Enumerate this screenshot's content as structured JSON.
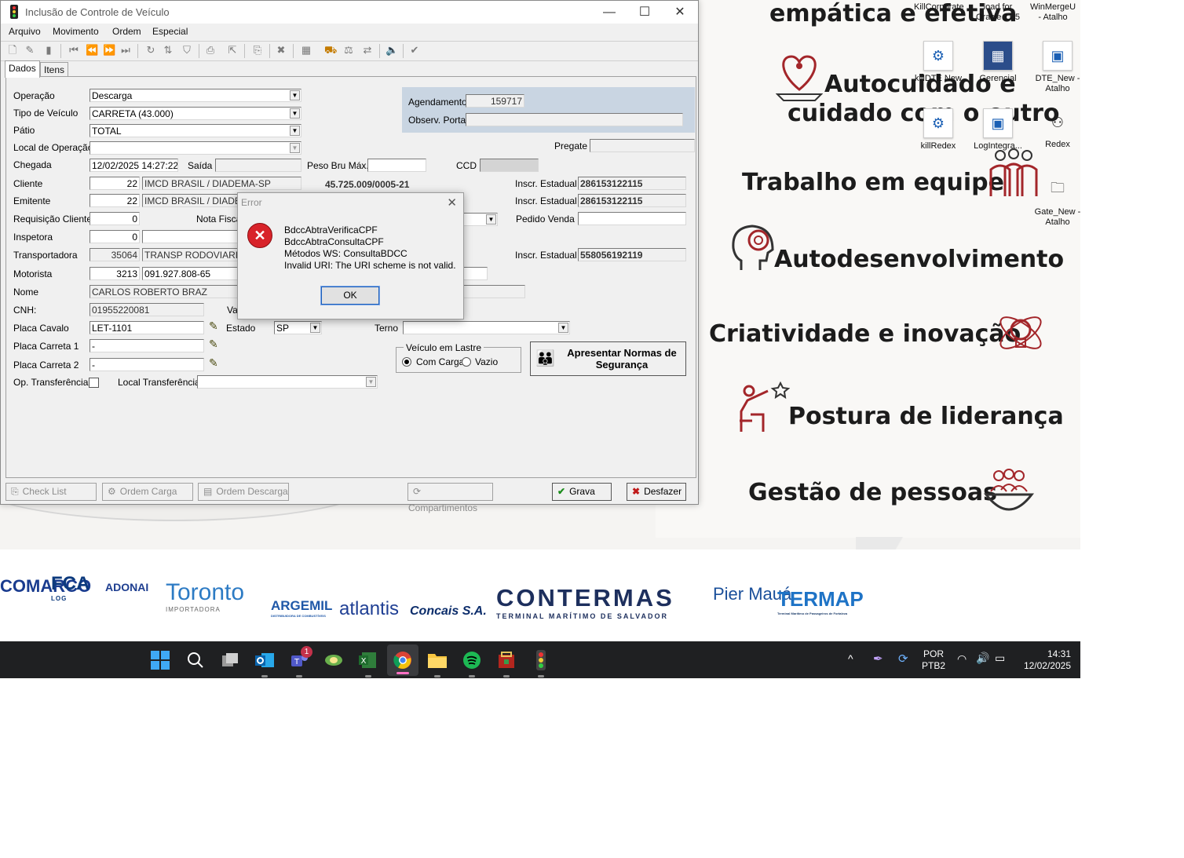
{
  "desktop": {
    "values": [
      {
        "text": "empática e efetiva"
      },
      {
        "text": "Autocuidado e"
      },
      {
        "text": "cuidado com o outro"
      },
      {
        "text": "Trabalho em equipe"
      },
      {
        "text": "Autodesenvolvimento"
      },
      {
        "text": "Criatividade e inovação"
      },
      {
        "text": "Postura de liderança"
      },
      {
        "text": "Gestão de pessoas"
      }
    ],
    "icons": [
      {
        "label": "KillCorporate",
        "icon": "gear-icon"
      },
      {
        "label": "load for Oracle 11.5",
        "icon": "app-icon"
      },
      {
        "label": "WinMergeU - Atalho",
        "icon": "shortcut-icon"
      },
      {
        "label": "killDTE New",
        "icon": "gear-icon"
      },
      {
        "label": "Gerencial",
        "icon": "app-icon"
      },
      {
        "label": "DTE_New - Atalho",
        "icon": "shortcut-icon"
      },
      {
        "label": "killRedex",
        "icon": "gear-icon"
      },
      {
        "label": "LogIntegra...",
        "icon": "shortcut-icon"
      },
      {
        "label": "Redex",
        "icon": "app-icon"
      },
      {
        "label": "Gate_New - Atalho",
        "icon": "shortcut-icon"
      }
    ],
    "logos": [
      {
        "name": "COMARCO",
        "color": "#1a3c8f"
      },
      {
        "name": "FCA",
        "sub": "LOG",
        "color": "#0c3a7d"
      },
      {
        "name": "ADONAI",
        "color": "#1d3d8f"
      },
      {
        "name": "Toronto",
        "sub": "IMPORTADORA",
        "color": "#2d7bc4"
      },
      {
        "name": "ARGEMIL",
        "sub": "DISTRIBUIDORA DE COMBUSTÍVEIS",
        "color": "#1f58a8"
      },
      {
        "name": "atlantis",
        "color": "#1f3f94"
      },
      {
        "name": "Concais S.A.",
        "color": "#0c2d6b"
      },
      {
        "name": "CONTERMAS",
        "sub": "TERMINAL MARÍTIMO DE SALVADOR",
        "color": "#1d2f5d"
      },
      {
        "name": "Pier Mauá",
        "color": "#1a4f9a"
      },
      {
        "name": "TERMAP",
        "sub": "Terminal Marítimo de Passageiros de Fortaleza",
        "color": "#1e73c6"
      }
    ],
    "accent": "#a3262a"
  },
  "taskbar": {
    "apps": [
      "windows-start-icon",
      "search-icon",
      "task-view-icon",
      "outlook-icon",
      "teams-icon",
      "app-icon",
      "excel-icon",
      "chrome-icon",
      "file-explorer-icon",
      "spotify-icon",
      "toolbox-icon",
      "traffic-light-icon"
    ],
    "teams_badge": "1",
    "lang_top": "POR",
    "lang_bottom": "PTB2",
    "time": "14:31",
    "date": "12/02/2025"
  },
  "window": {
    "title": "Inclusão de Controle de Veículo",
    "menu": [
      "Arquivo",
      "Movimento",
      "Ordem",
      "Especial"
    ],
    "tabs": [
      "Dados",
      "Itens"
    ],
    "form": {
      "operacao_label": "Operação",
      "operacao": "Descarga",
      "tipo_veiculo_label": "Tipo de Veículo",
      "tipo_veiculo": "CARRETA (43.000)",
      "patio_label": "Pátio",
      "patio": "TOTAL",
      "local_operacao_label": "Local de Operação",
      "local_operacao": "",
      "chegada_label": "Chegada",
      "chegada": "12/02/2025 14:27:22",
      "saida_label": "Saída",
      "saida": "",
      "peso_label": "Peso Bru Máx.",
      "peso": "",
      "ccd_label": "CCD",
      "ccd": "",
      "agendamento_label": "Agendamento",
      "agendamento": "159717",
      "observ_label": "Observ. Portal",
      "observ": "",
      "pregate_label": "Pregate",
      "pregate": "",
      "cliente_label": "Cliente",
      "cliente_cod": "22",
      "cliente_nome": "IMCD BRASIL / DIADEMA-SP",
      "cliente_cnpj": "45.725.009/0005-21",
      "ie_label": "Inscr. Estadual",
      "cliente_ie": "286153122115",
      "emitente_label": "Emitente",
      "emitente_cod": "22",
      "emitente_nome": "IMCD BRASIL / DIADEM",
      "emitente_ie": "286153122115",
      "requisicao_label": "Requisição Cliente",
      "requisicao": "0",
      "nota_label": "Nota Fiscal",
      "pedido_label": "Pedido Venda",
      "pedido": "",
      "inspetora_label": "Inspetora",
      "inspetora": "0",
      "transportadora_label": "Transportadora",
      "transportadora_cod": "35064",
      "transportadora_nome": "TRANSP RODOVIARIO",
      "transportadora_ie": "558056192119",
      "motorista_label": "Motorista",
      "motorista_cod": "3213",
      "motorista_cpf": "091.927.808-65",
      "nome_label": "Nome",
      "nome": "CARLOS ROBERTO BRAZ",
      "cnh_label": "CNH:",
      "cnh": "01955220081",
      "va_label": "Va",
      "placa_cavalo_label": "Placa Cavalo",
      "placa_cavalo": "LET-1101",
      "estado_label": "Estado",
      "estado": "SP",
      "terno_label": "Terno",
      "terno": "",
      "placa_carreta1_label": "Placa Carreta 1",
      "placa_carreta1": " -",
      "placa_carreta2_label": "Placa Carreta 2",
      "placa_carreta2": " -",
      "op_transf_label": "Op. Transferência",
      "local_transf_label": "Local Transferência",
      "local_transf": "",
      "veiculo_lastre_label": "Veículo em Lastre",
      "com_carga": "Com Carga",
      "vazio": "Vazio",
      "normas_button": "Apresentar Normas de Segurança"
    },
    "buttons": {
      "check_list": "Check List",
      "ordem_carga": "Ordem Carga",
      "ordem_descarga": "Ordem Descarga",
      "compartimentos": "Compartimentos",
      "grava": "Grava",
      "desfazer": "Desfazer"
    }
  },
  "error_dialog": {
    "title": "Error",
    "lines": [
      "BdccAbtraVerificaCPF",
      "BdccAbtraConsultaCPF",
      "Métodos WS: ConsultaBDCC",
      "Invalid URI: The URI scheme is not valid."
    ],
    "ok": "OK"
  }
}
